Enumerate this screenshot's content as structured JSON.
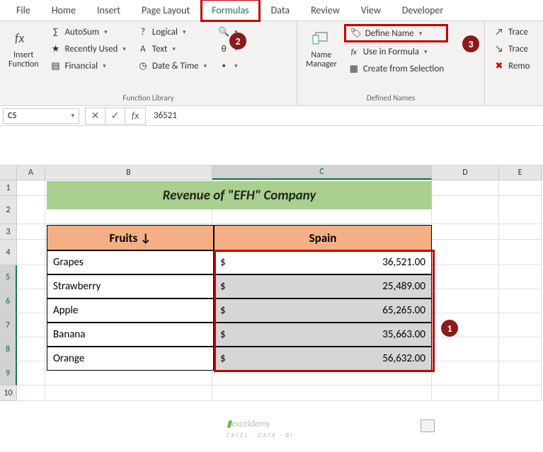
{
  "tabs": [
    "File",
    "Home",
    "Insert",
    "Page Layout",
    "Formulas",
    "Data",
    "Review",
    "View",
    "Developer"
  ],
  "active_tab": "Formulas",
  "ribbon": {
    "insert_function": "Insert\nFunction",
    "autosum": "AutoSum",
    "recently": "Recently Used",
    "financial": "Financial",
    "logical": "Logical",
    "text": "Text",
    "datetime": "Date & Time",
    "group1_label": "Function Library",
    "name_manager": "Name\nManager",
    "define_name": "Define Name",
    "use_in_formula": "Use in Formula",
    "create_selection": "Create from Selection",
    "group2_label": "Defined Names",
    "trace1": "Trace",
    "trace2": "Trace",
    "remo": "Remo"
  },
  "namebox": "C5",
  "formula_value": "36521",
  "columns": [
    "A",
    "B",
    "C",
    "D",
    "E"
  ],
  "title": "Revenue of \"EFH\" Company",
  "headers": {
    "fruits": "Fruits ↓",
    "spain": "Spain"
  },
  "chart_data": {
    "type": "table",
    "title": "Revenue of \"EFH\" Company",
    "columns": [
      "Fruits",
      "Spain"
    ],
    "rows": [
      {
        "fruit": "Grapes",
        "value": 36521.0,
        "display": "36,521.00"
      },
      {
        "fruit": "Strawberry",
        "value": 25489.0,
        "display": "25,489.00"
      },
      {
        "fruit": "Apple",
        "value": 65265.0,
        "display": "65,265.00"
      },
      {
        "fruit": "Banana",
        "value": 35663.0,
        "display": "35,663.00"
      },
      {
        "fruit": "Orange",
        "value": 56632.0,
        "display": "56,632.00"
      }
    ]
  },
  "badges": {
    "b1": "1",
    "b2": "2",
    "b3": "3"
  },
  "watermark": "exceldemy",
  "watermark_sub": "EXCEL · DATA · BI",
  "currency": "$"
}
